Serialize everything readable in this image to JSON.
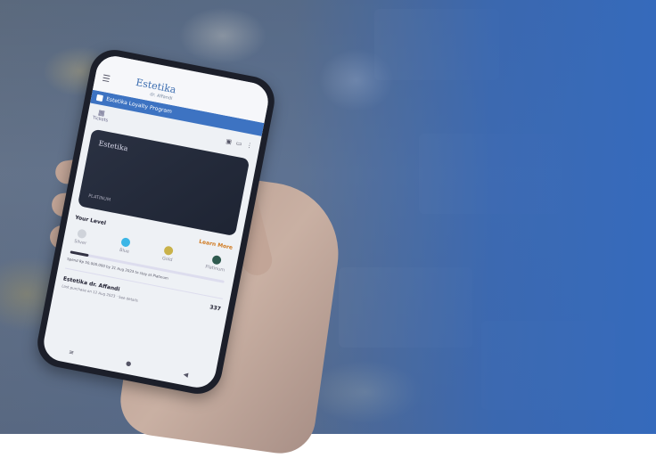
{
  "app": {
    "brand": "Estetika",
    "brand_sub": "dr. Affandi",
    "banner_text": "Estetika Loyalty Program",
    "tickets_label": "Tickets",
    "card_tier": "PLATINUM",
    "tier_section_title": "Your Level",
    "tier_section_link": "Learn More",
    "tiers": [
      {
        "name": "Silver",
        "color": "#cfd3da"
      },
      {
        "name": "Blue",
        "color": "#3cb6e6"
      },
      {
        "name": "Gold",
        "color": "#c9b24a"
      },
      {
        "name": "Platinum",
        "color": "#2f5a4f"
      }
    ],
    "progress_fraction": 0.12,
    "progress_note": "Spend Rp 50.000.000 by 31 Aug 2023 to stay at Platinum",
    "store_name": "Estetika dr. Affandi",
    "store_sub": "Last purchase on 12 Aug 2023 · See details",
    "store_value": "337"
  },
  "icons": {
    "menu": "menu-icon",
    "gift": "gift-icon",
    "qr": "qr-icon",
    "wallet": "wallet-icon",
    "more": "more-icon"
  }
}
